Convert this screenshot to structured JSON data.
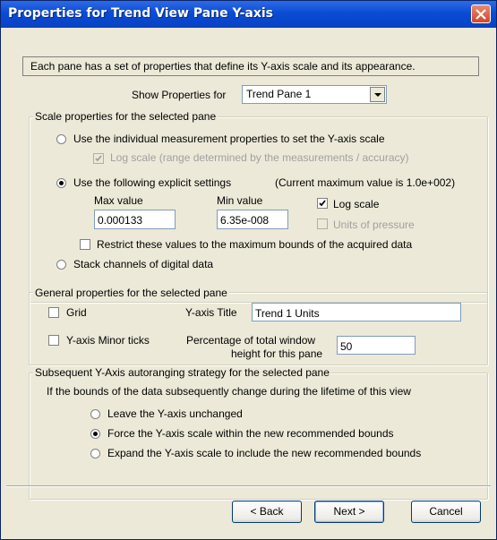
{
  "window": {
    "title": "Properties for Trend View Pane Y-axis",
    "title_bar_color": "#0A4CD4",
    "close_icon": "close-icon"
  },
  "description": "Each pane has a set of properties that define its Y-axis scale and its appearance.",
  "show_properties": {
    "label": "Show Properties for",
    "selected": "Trend Pane 1"
  },
  "scale": {
    "group_label": "Scale properties for the selected pane",
    "option_individual": "Use the individual measurement properties to set the Y-axis scale",
    "log_scale_range": "Log scale (range determined by the measurements / accuracy)",
    "option_explicit": "Use the following explicit settings",
    "current_max": "(Current maximum value is 1.0e+002)",
    "max_label": "Max value",
    "max_value": "0.000133",
    "min_label": "Min value",
    "min_value": "6.35e-008",
    "log_scale": "Log scale",
    "units_of_pressure": "Units of pressure",
    "restrict": "Restrict these values to the maximum bounds of the acquired data",
    "option_stack": "Stack channels of digital data",
    "selected_option": "explicit"
  },
  "general": {
    "group_label": "General properties for the selected pane",
    "grid": "Grid",
    "y_axis_title_label": "Y-axis Title",
    "y_axis_title_value": "Trend 1 Units",
    "minor_ticks": "Y-axis Minor ticks",
    "percentage_label_1": "Percentage of total window",
    "percentage_label_2": "height for this pane",
    "percentage_value": "50"
  },
  "autorange": {
    "group_label": "Subsequent Y-Axis autoranging strategy for the selected pane",
    "intro": "If the bounds of the data subsequently change during the lifetime of this view",
    "option_unchanged": "Leave the Y-axis unchanged",
    "option_force": "Force the Y-axis scale within the new recommended bounds",
    "option_expand": "Expand the Y-axis scale to include the new recommended bounds",
    "selected_option": "force"
  },
  "buttons": {
    "back": "< Back",
    "next": "Next >",
    "cancel": "Cancel"
  }
}
